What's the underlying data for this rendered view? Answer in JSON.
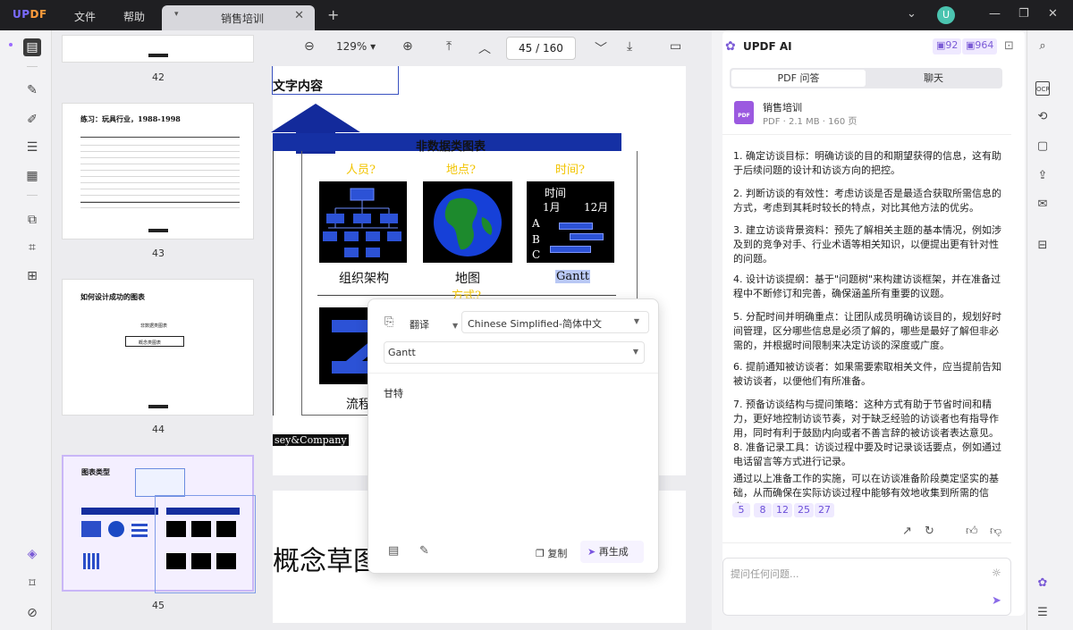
{
  "app": {
    "logo_text": "UPDF",
    "menu": [
      "文件",
      "帮助"
    ],
    "tab_title": "销售培训",
    "avatar_letter": "U"
  },
  "toolbar": {
    "zoom": "129%",
    "page_current": "45",
    "page_sep": "/",
    "page_total": "160"
  },
  "thumbnails": [
    {
      "page_label": "42"
    },
    {
      "page_label": "43",
      "title": "练习：玩具行业，1988-1998"
    },
    {
      "page_label": "44",
      "title": "如何设计成功的图表",
      "items": [
        "非数据类图表",
        "概念类图表"
      ]
    },
    {
      "page_label": "45",
      "title": "图表类型"
    }
  ],
  "page": {
    "top_text": "文字内容",
    "banner_title": "非数据类图表",
    "q1": "人员?",
    "q2": "地点?",
    "q3": "时间?",
    "gantt_header": "时间",
    "gantt_m1": "1月",
    "gantt_m2": "12月",
    "gantt_rows": [
      "A",
      "B",
      "C"
    ],
    "label1": "组织架构",
    "label2": "地图",
    "label3": "Gantt",
    "q4": "方式?",
    "label4": "流程",
    "brand": "sey&Company",
    "page2_text": "概念草图"
  },
  "translate_popup": {
    "mode": "翻译",
    "language": "Chinese Simplified-简体中文",
    "source_text": "Gantt",
    "result_text": "甘特",
    "copy_label": "复制",
    "regen_label": "再生成"
  },
  "ai_panel": {
    "title": "UPDF AI",
    "credit1": "92",
    "credit2": "964",
    "tabs": [
      "PDF 问答",
      "聊天"
    ],
    "file_name": "销售培训",
    "file_meta": "PDF · 2.1 MB · 160 页",
    "paragraphs": [
      "1. 确定访谈目标：明确访谈的目的和期望获得的信息，这有助于后续问题的设计和访谈方向的把控。",
      "2. 判断访谈的有效性：考虑访谈是否是最适合获取所需信息的方式，考虑到其耗时较长的特点，对比其他方法的优劣。",
      "3. 建立访谈背景资料：预先了解相关主题的基本情况，例如涉及到的竞争对手、行业术语等相关知识，以便提出更有针对性的问题。",
      "4. 设计访谈提纲：基于\"问题树\"来构建访谈框架，并在准备过程中不断修订和完善，确保涵盖所有重要的议题。",
      "5. 分配时间并明确重点：让团队成员明确访谈目的，规划好时间管理，区分哪些信息是必须了解的，哪些是最好了解但非必需的，并根据时间限制来决定访谈的深度或广度。",
      "6. 提前通知被访谈者：如果需要索取相关文件，应当提前告知被访谈者，以便他们有所准备。",
      "7. 预备访谈结构与提问策略：这种方式有助于节省时间和精力，更好地控制访谈节奏，对于缺乏经验的访谈者也有指导作用，同时有利于鼓励内向或者不善言辞的被访谈者表达意见。8. 准备记录工具：访谈过程中要及时记录谈话要点，例如通过电话留言等方式进行记录。",
      "通过以上准备工作的实施，可以在访谈准备阶段奠定坚实的基础，从而确保在实际访谈过程中能够有效地收集到所需的信息。"
    ],
    "refs": [
      "5",
      "8",
      "12",
      "25",
      "27"
    ],
    "ask_placeholder": "提问任何问题..."
  }
}
